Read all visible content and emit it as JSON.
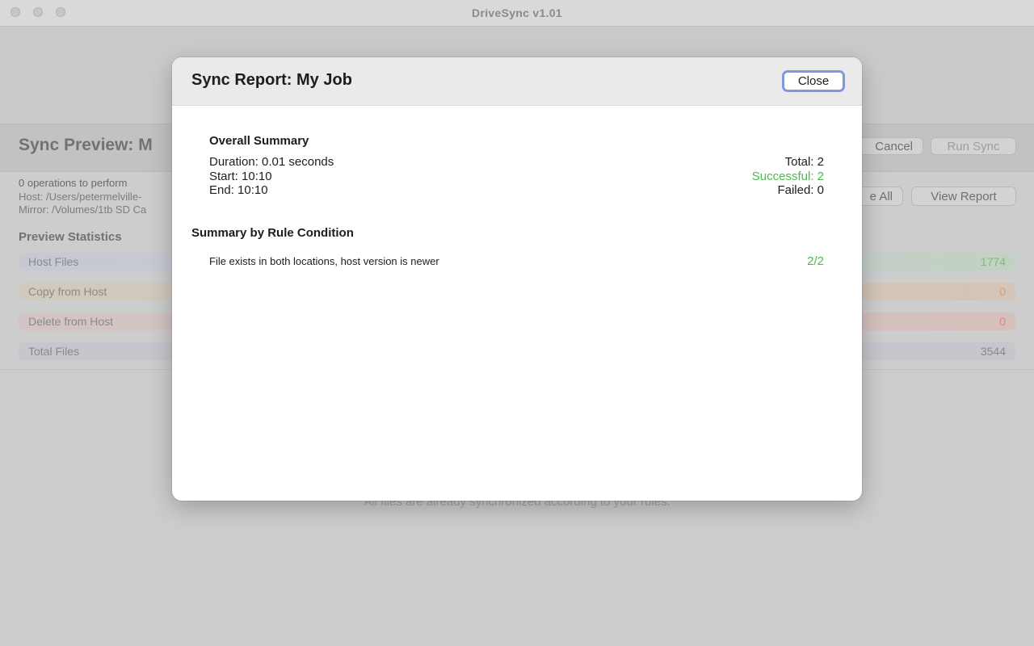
{
  "app": {
    "window_title": "DriveSync v1.01"
  },
  "background": {
    "preview_title": "Sync Preview: M",
    "cancel_label": "Cancel",
    "run_sync_label": "Run Sync",
    "operations_text": "0 operations to perform",
    "host_path": "Host: /Users/petermelville-",
    "mirror_path": "Mirror: /Volumes/1tb SD Ca",
    "approve_all_label": "e All",
    "view_report_label": "View Report",
    "stats_title": "Preview Statistics",
    "stats": [
      {
        "label": "Host Files",
        "value": "1774"
      },
      {
        "label": "Copy from Host",
        "value": "0"
      },
      {
        "label": "Delete from Host",
        "value": "0"
      },
      {
        "label": "Total Files",
        "value": "3544"
      }
    ],
    "footer_text": "All files are already synchronized according to your rules."
  },
  "modal": {
    "title": "Sync Report: My Job",
    "close_label": "Close",
    "overall_title": "Overall Summary",
    "duration": "Duration: 0.01 seconds",
    "start": "Start: 10:10",
    "end": "End: 10:10",
    "total": "Total: 2",
    "successful": "Successful: 2",
    "failed": "Failed: 0",
    "rule_section_title": "Summary by Rule Condition",
    "rules": [
      {
        "condition": "File exists in both locations, host version is newer",
        "ratio": "2/2"
      }
    ]
  },
  "colors": {
    "success_green": "#4cb84c",
    "focus_ring": "#7e98e0"
  }
}
